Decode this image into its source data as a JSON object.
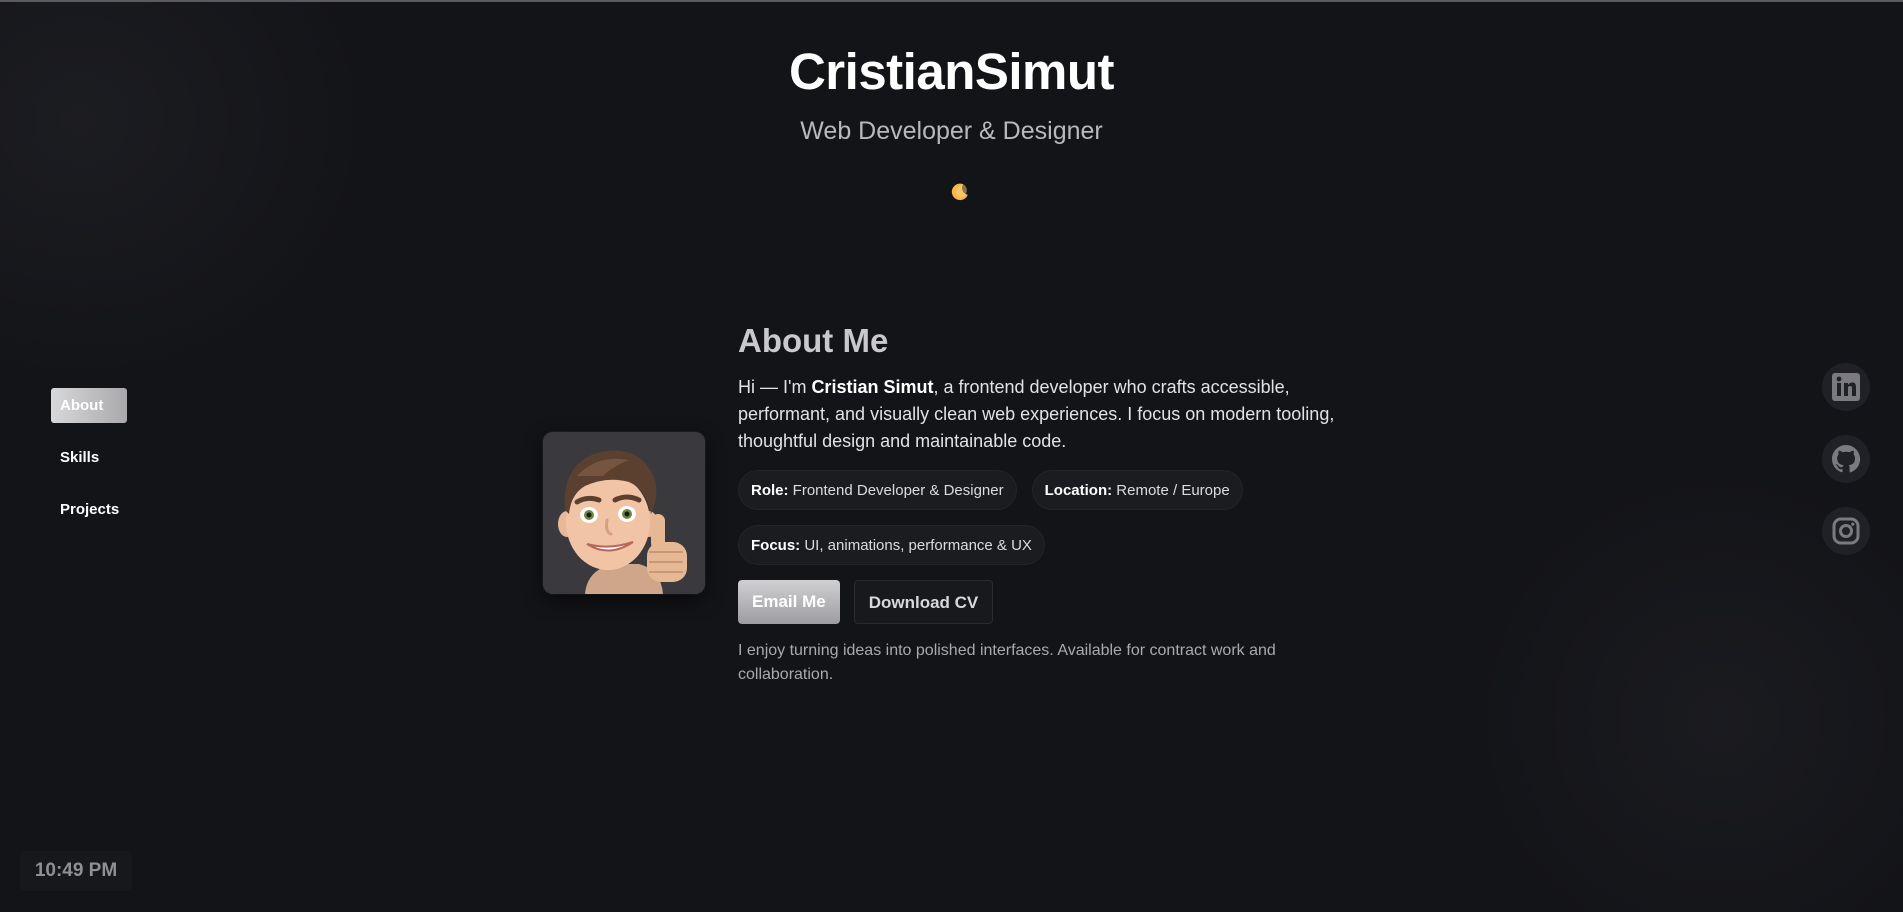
{
  "header": {
    "title": "CristianSimut",
    "subtitle": "Web Developer & Designer",
    "theme_icon": "moon-icon"
  },
  "nav": {
    "items": [
      {
        "label": "About",
        "active": true
      },
      {
        "label": "Skills",
        "active": false
      },
      {
        "label": "Projects",
        "active": false
      }
    ]
  },
  "about": {
    "heading": "About Me",
    "intro_prefix": "Hi — I'm ",
    "intro_name": "Cristian Simut",
    "intro_suffix": ", a frontend developer who crafts accessible, performant, and visually clean web experiences. I focus on modern tooling, thoughtful design and maintainable code.",
    "chips": [
      {
        "key": "Role:",
        "value": "Frontend Developer & Designer"
      },
      {
        "key": "Location:",
        "value": "Remote / Europe"
      },
      {
        "key": "Focus:",
        "value": "UI, animations, performance & UX"
      }
    ],
    "email_button": "Email Me",
    "cv_button": "Download CV",
    "note": "I enjoy turning ideas into polished interfaces. Available for contract work and collaboration.",
    "avatar_icon": "memoji-avatar-thumbs-up"
  },
  "social": [
    {
      "icon": "linkedin-icon"
    },
    {
      "icon": "github-icon"
    },
    {
      "icon": "instagram-icon"
    }
  ],
  "clock": {
    "time": "10:49 PM"
  },
  "colors": {
    "background": "#131418",
    "title": "#ffffff",
    "accent_moon": "#f5b84a"
  }
}
